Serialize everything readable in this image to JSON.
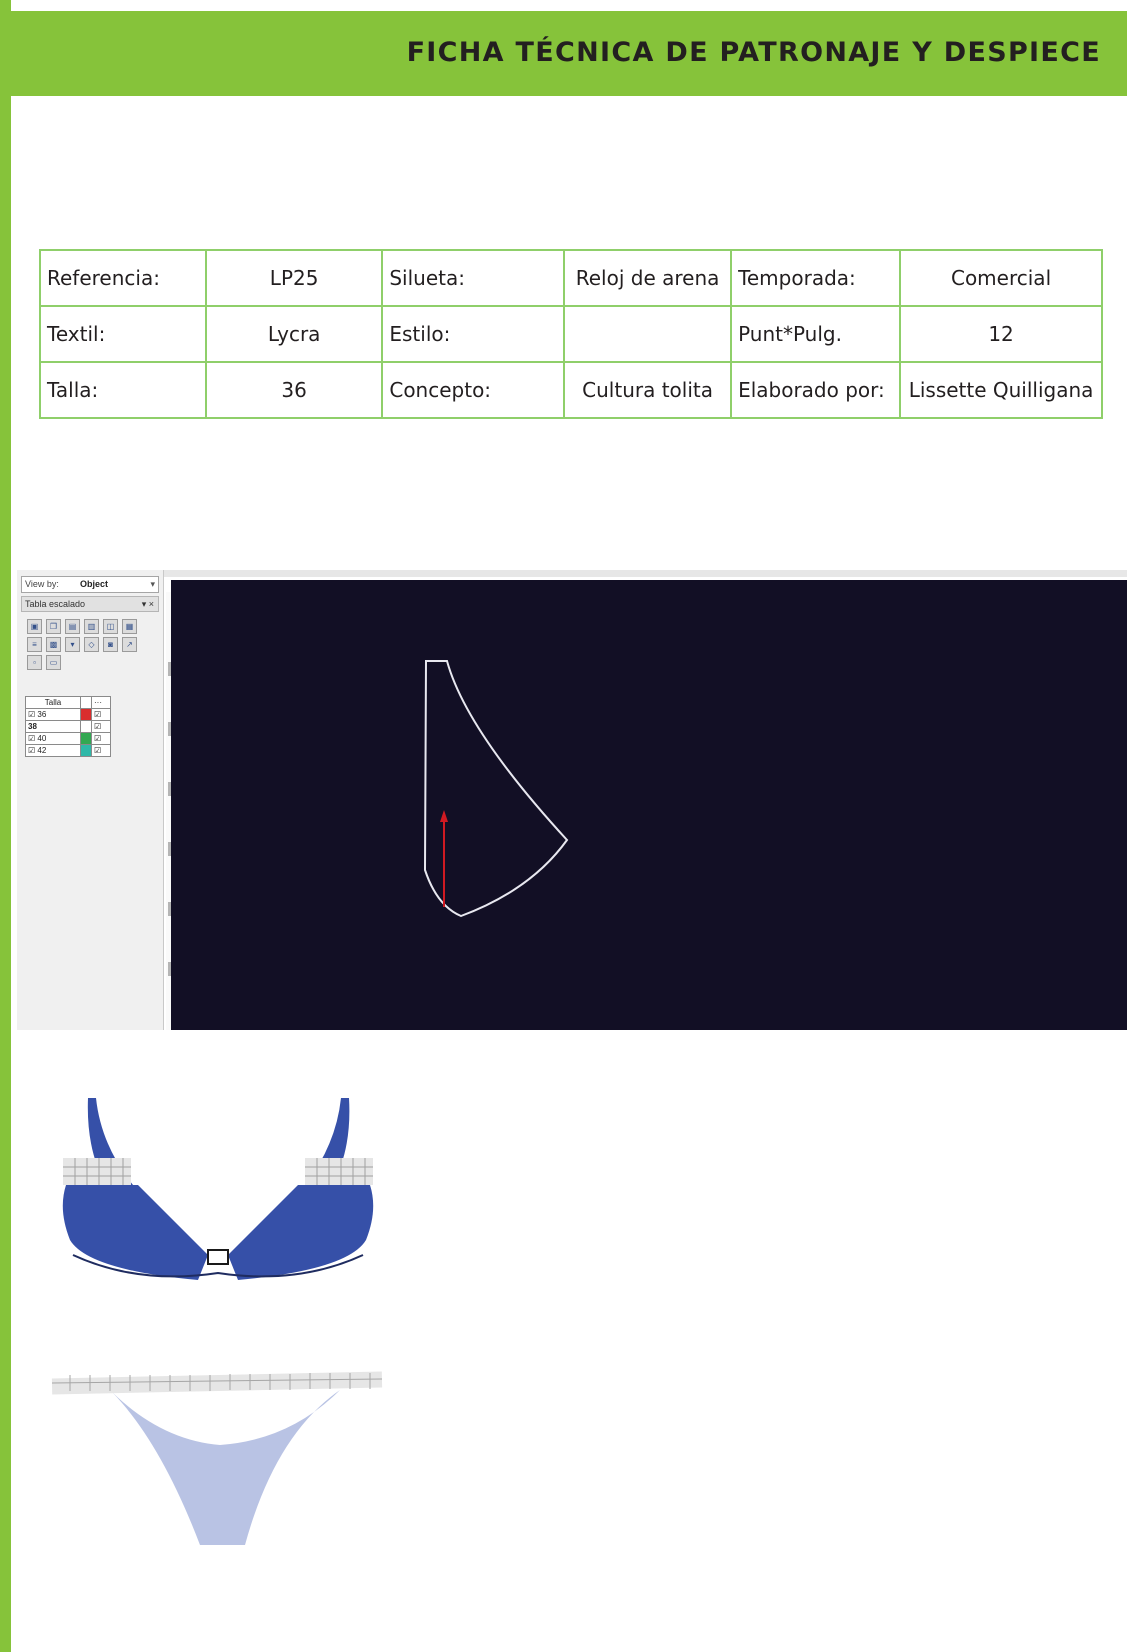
{
  "header": {
    "title": "FICHA TÉCNICA DE PATRONAJE Y DESPIECE"
  },
  "spec_table": [
    [
      {
        "text": "Referencia:"
      },
      {
        "text": "LP25"
      },
      {
        "text": "Silueta:"
      },
      {
        "text": "Reloj de arena"
      },
      {
        "text": "Temporada:"
      },
      {
        "text": "Comercial"
      }
    ],
    [
      {
        "text": "Textil:"
      },
      {
        "text": "Lycra"
      },
      {
        "text": "Estilo:"
      },
      {
        "text": ""
      },
      {
        "text": "Punt*Pulg."
      },
      {
        "text": "12"
      }
    ],
    [
      {
        "text": "Talla:"
      },
      {
        "text": "36"
      },
      {
        "text": "Concepto:"
      },
      {
        "text": "Cultura tolita"
      },
      {
        "text": "Elaborado por:"
      },
      {
        "text": "Lissette Quilligana"
      }
    ]
  ],
  "cad_window": {
    "view_by_label": "View by:",
    "view_by_value": "Object",
    "panel_title": "Tabla escalado",
    "panel_controls": "▾ ×",
    "toolbar_icons": [
      "select-icon",
      "copy-icon",
      "paste-icon",
      "grade-icon",
      "mirror-icon",
      "print-icon",
      "list-icon",
      "table-icon",
      "dropdown-icon",
      "link-icon",
      "camera-icon",
      "export-icon",
      "delete-icon",
      "undo-icon"
    ],
    "size_table_header": "Talla",
    "sizes": [
      {
        "label": "36",
        "checked": true,
        "color": "#d92d2d"
      },
      {
        "label": "38",
        "checked": false,
        "color": "#ffffff"
      },
      {
        "label": "40",
        "checked": true,
        "color": "#33a852"
      },
      {
        "label": "42",
        "checked": true,
        "color": "#2fb8a8"
      }
    ],
    "colors": {
      "canvas": "#120f25",
      "pattern_outline": "#e8e8f0",
      "grain_line": "#d01a22"
    }
  },
  "illustrations": {
    "bikini_top": {
      "color": "#3650a8",
      "trim": "#e6e6e6"
    },
    "bikini_bottom": {
      "color": "#b9c3e4",
      "trim": "#e6e6e6"
    }
  }
}
